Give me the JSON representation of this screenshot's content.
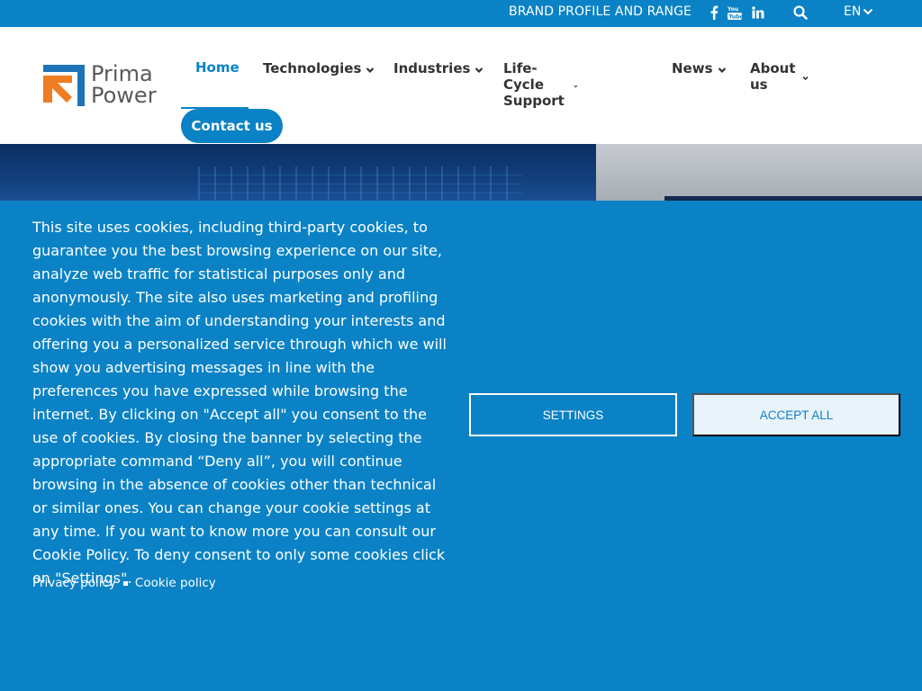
{
  "topbar": {
    "brand_link": "BRAND PROFILE AND RANGE",
    "social": [
      "facebook-icon",
      "youtube-icon",
      "linkedin-icon"
    ],
    "search_icon": "search-icon",
    "language": "EN"
  },
  "header": {
    "logo_line1": "Prima",
    "logo_line2": "Power",
    "nav": [
      {
        "label": "Home",
        "active": true
      },
      {
        "label": "Technologies"
      },
      {
        "label": "Industries"
      },
      {
        "label": "Life-Cycle Support"
      },
      {
        "label": "News"
      },
      {
        "label": "About us"
      }
    ],
    "contact_label": "Contact us"
  },
  "cookie_banner": {
    "text": "This site uses cookies, including third-party cookies, to guarantee you the best browsing experience on our site, analyze web traffic for statistical purposes only and anonymously. The site also uses marketing and profiling cookies with the aim of understanding your interests and offering you a personalized service through which we will show you advertising messages in line with the preferences you have expressed while browsing the internet. By clicking on \"Accept all\" you consent to the use of cookies. By closing the banner by selecting the appropriate command “Deny all”, you will continue browsing in the absence of cookies other than technical or similar ones. You can change your cookie settings at any time. If you want to know more you can consult our Cookie Policy. To deny consent to only some cookies click on \"Settings\".",
    "privacy_link": "Privacy policy",
    "cookie_link": "Cookie policy",
    "settings_label": "SETTINGS",
    "accept_label": "ACCEPT ALL"
  },
  "colors": {
    "brand_blue": "#0a82c5",
    "logo_orange": "#ef7d22",
    "text_dark": "#333333"
  }
}
